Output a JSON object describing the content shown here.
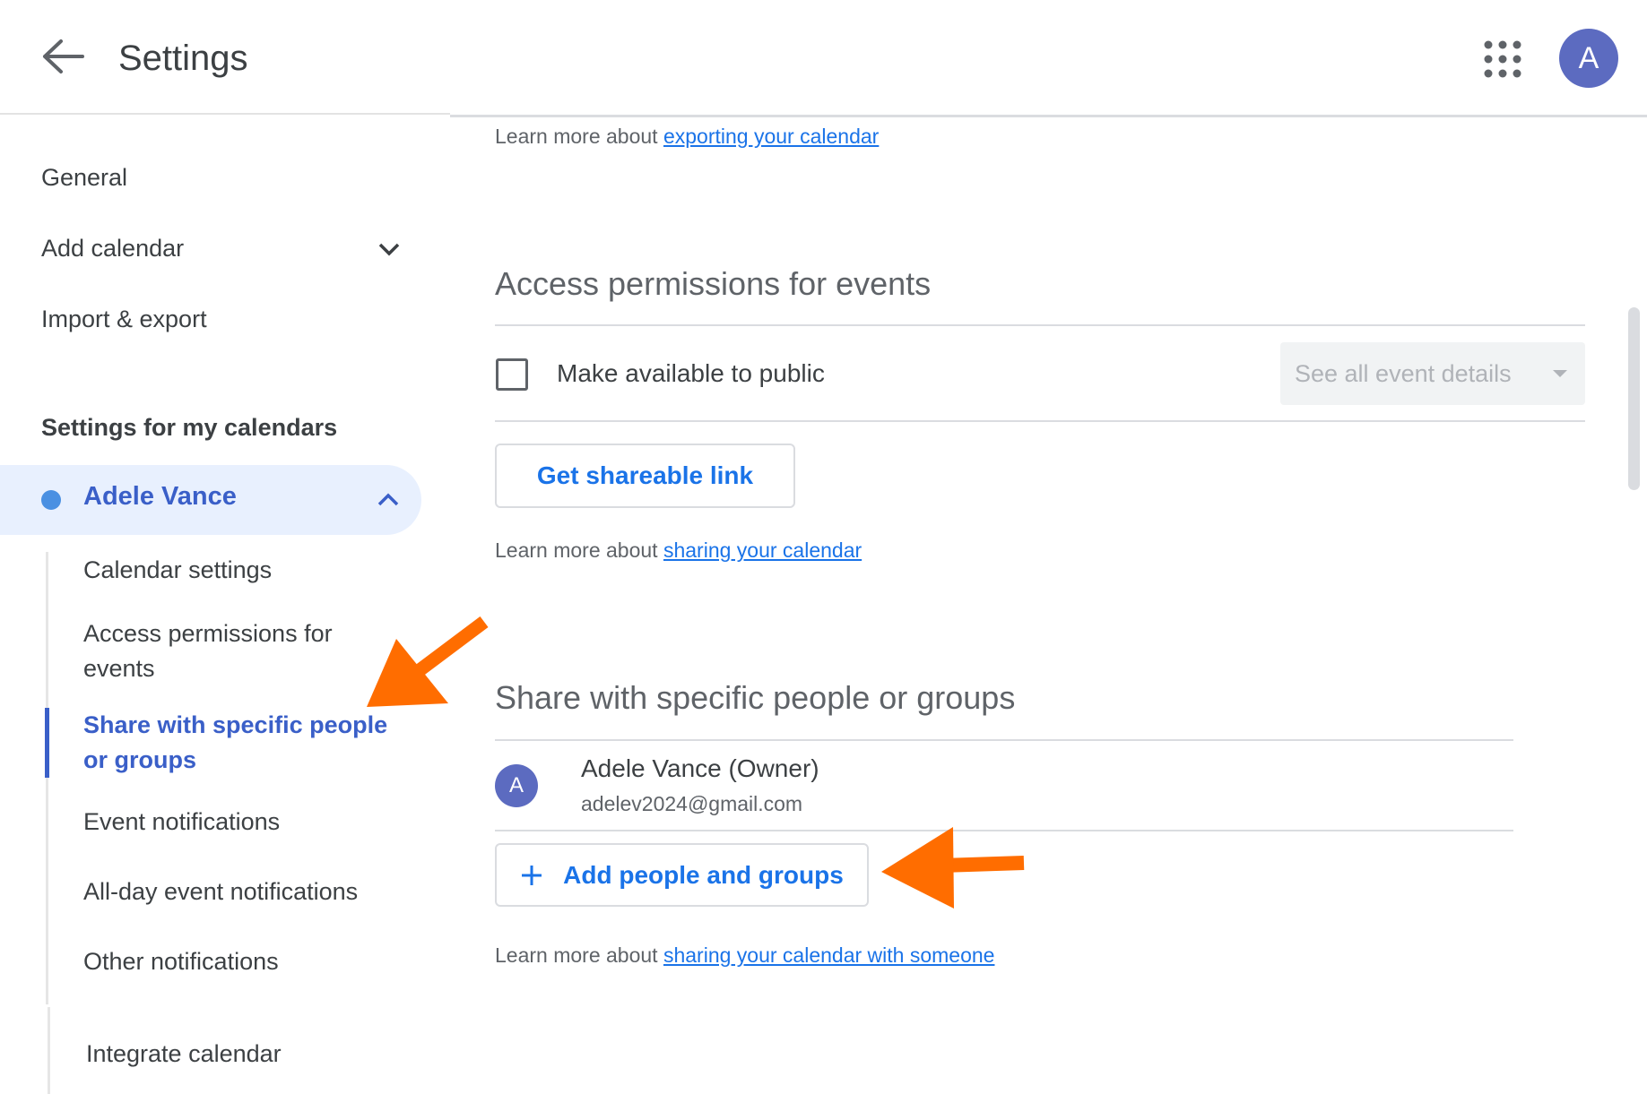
{
  "header": {
    "title": "Settings",
    "avatar_letter": "A"
  },
  "sidebar": {
    "items": [
      {
        "label": "General"
      },
      {
        "label": "Add calendar"
      },
      {
        "label": "Import & export"
      }
    ],
    "section_label": "Settings for my calendars",
    "calendar": {
      "name": "Adele Vance",
      "dot_color": "#4a90e2",
      "sub_items": [
        {
          "label": "Calendar settings"
        },
        {
          "label": "Access permissions for events"
        },
        {
          "label": "Share with specific people or groups",
          "active": true
        },
        {
          "label": "Event notifications"
        },
        {
          "label": "All-day event notifications"
        },
        {
          "label": "Other notifications"
        },
        {
          "label": "Integrate calendar"
        }
      ]
    }
  },
  "main": {
    "export_learn": {
      "prefix": "Learn more about",
      "link": "exporting your calendar"
    },
    "access": {
      "title": "Access permissions for events",
      "public_label": "Make available to public",
      "public_checked": false,
      "detail_select": "See all event details",
      "share_link_button": "Get shareable link",
      "learn": {
        "prefix": "Learn more about",
        "link": "sharing your calendar"
      }
    },
    "share": {
      "title": "Share with specific people or groups",
      "people": [
        {
          "avatar_letter": "A",
          "name": "Adele Vance (Owner)",
          "email": "adelev2024@gmail.com"
        }
      ],
      "add_button": "Add people and groups",
      "learn": {
        "prefix": "Learn more about",
        "link": "sharing your calendar with someone"
      }
    }
  },
  "colors": {
    "accent": "#1a73e8",
    "active_nav": "#3a5fc8",
    "highlight_arrow": "#ff6d00"
  }
}
